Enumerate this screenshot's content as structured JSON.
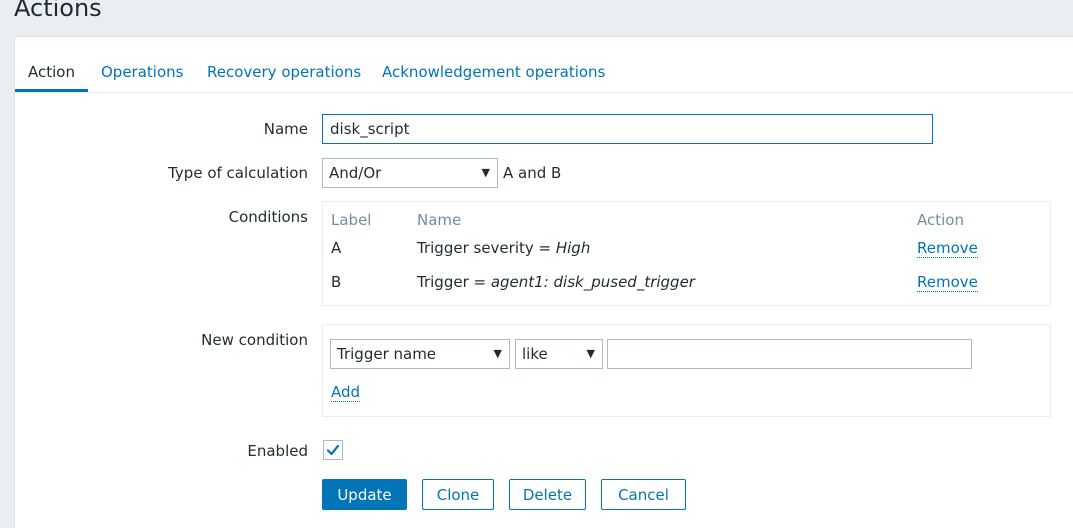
{
  "page": {
    "title": "Actions"
  },
  "tabs": [
    {
      "label": "Action"
    },
    {
      "label": "Operations"
    },
    {
      "label": "Recovery operations"
    },
    {
      "label": "Acknowledgement operations"
    }
  ],
  "form": {
    "name": {
      "label": "Name",
      "value": "disk_script"
    },
    "calculation": {
      "label": "Type of calculation",
      "selected": "And/Or",
      "formula": "A and B"
    },
    "conditions": {
      "label": "Conditions",
      "headers": {
        "label": "Label",
        "name": "Name",
        "action": "Action"
      },
      "rows": [
        {
          "label": "A",
          "name_prefix": "Trigger severity = ",
          "name_value": "High",
          "action": "Remove"
        },
        {
          "label": "B",
          "name_prefix": "Trigger = ",
          "name_value": "agent1: disk_pused_trigger",
          "action": "Remove"
        }
      ]
    },
    "new_condition": {
      "label": "New condition",
      "type_selected": "Trigger name",
      "operator_selected": "like",
      "value": "",
      "add_label": "Add"
    },
    "enabled": {
      "label": "Enabled",
      "checked": true
    }
  },
  "buttons": {
    "update": "Update",
    "clone": "Clone",
    "delete": "Delete",
    "cancel": "Cancel"
  },
  "colors": {
    "accent": "#0275b8",
    "background": "#ebeef0",
    "text": "#1f2c33",
    "muted": "#768d99"
  }
}
